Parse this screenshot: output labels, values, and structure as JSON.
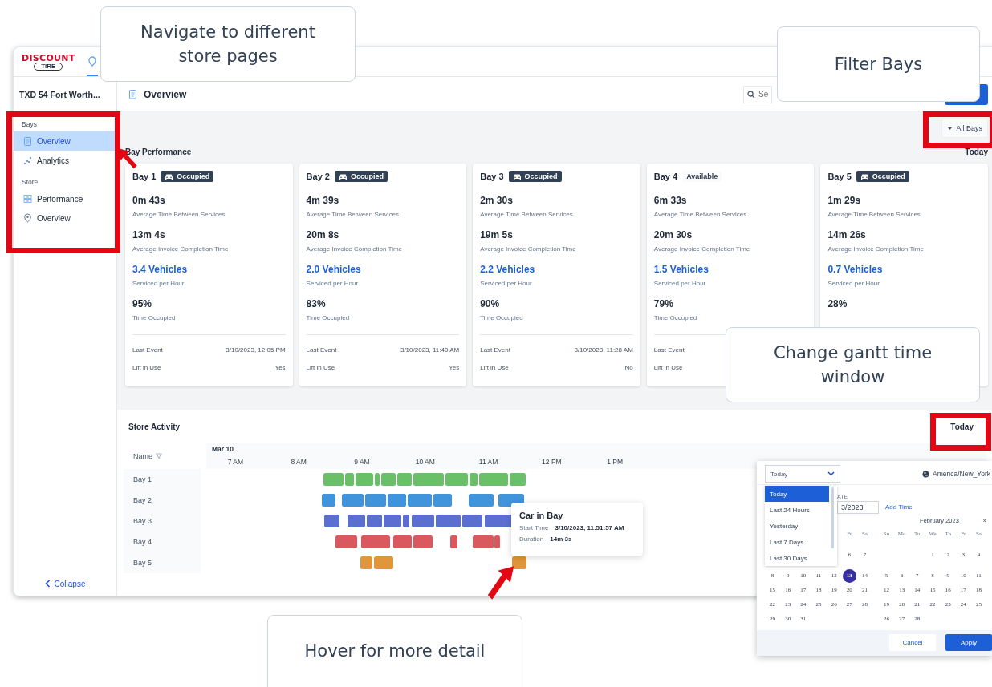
{
  "logo": {
    "top": "DISCOUNT",
    "bottom": "TIRE"
  },
  "sidebar": {
    "store": "TXD 54 Fort Worth...",
    "sections": [
      {
        "title": "Bays",
        "items": [
          {
            "label": "Overview",
            "selected": true
          },
          {
            "label": "Analytics",
            "selected": false
          }
        ]
      },
      {
        "title": "Store",
        "items": [
          {
            "label": "Performance",
            "selected": false
          },
          {
            "label": "Overview",
            "selected": false
          }
        ]
      }
    ],
    "collapse": "Collapse"
  },
  "page_title": "Overview",
  "search": {
    "placeholder": "Se"
  },
  "filter": {
    "label": "All Bays"
  },
  "bay_performance": {
    "title": "Bay Performance",
    "range": "Today",
    "cards": [
      {
        "name": "Bay 1",
        "status": {
          "kind": "occupied",
          "label": "Occupied"
        },
        "stats": [
          {
            "kind": "time",
            "value": "0m 43s",
            "label": "Average Time Between Services"
          },
          {
            "kind": "time",
            "value": "13m 4s",
            "label": "Average Invoice Completion Time"
          },
          {
            "kind": "rate",
            "value": "3.4 Vehicles",
            "label": "Serviced per Hour"
          },
          {
            "kind": "time",
            "value": "95%",
            "label": "Time Occupied"
          }
        ],
        "details": [
          {
            "label": "Last Event",
            "value": "3/10/2023, 12:05 PM"
          },
          {
            "label": "Lift in Use",
            "value": "Yes"
          }
        ]
      },
      {
        "name": "Bay 2",
        "status": {
          "kind": "occupied",
          "label": "Occupied"
        },
        "stats": [
          {
            "kind": "time",
            "value": "4m 39s",
            "label": "Average Time Between Services"
          },
          {
            "kind": "time",
            "value": "20m 8s",
            "label": "Average Invoice Completion Time"
          },
          {
            "kind": "rate",
            "value": "2.0 Vehicles",
            "label": "Serviced per Hour"
          },
          {
            "kind": "time",
            "value": "83%",
            "label": "Time Occupied"
          }
        ],
        "details": [
          {
            "label": "Last Event",
            "value": "3/10/2023, 11:40 AM"
          },
          {
            "label": "Lift in Use",
            "value": "Yes"
          }
        ]
      },
      {
        "name": "Bay 3",
        "status": {
          "kind": "occupied",
          "label": "Occupied"
        },
        "stats": [
          {
            "kind": "time",
            "value": "2m 30s",
            "label": "Average Time Between Services"
          },
          {
            "kind": "time",
            "value": "19m 5s",
            "label": "Average Invoice Completion Time"
          },
          {
            "kind": "rate",
            "value": "2.2 Vehicles",
            "label": "Serviced per Hour"
          },
          {
            "kind": "time",
            "value": "90%",
            "label": "Time Occupied"
          }
        ],
        "details": [
          {
            "label": "Last Event",
            "value": "3/10/2023, 11:28 AM"
          },
          {
            "label": "Lift in Use",
            "value": "No"
          }
        ]
      },
      {
        "name": "Bay 4",
        "status": {
          "kind": "available",
          "label": "Available"
        },
        "stats": [
          {
            "kind": "time",
            "value": "6m 33s",
            "label": "Average Time Between Services"
          },
          {
            "kind": "time",
            "value": "20m 30s",
            "label": "Average Invoice Completion Time"
          },
          {
            "kind": "rate",
            "value": "1.5 Vehicles",
            "label": "Serviced per Hour"
          },
          {
            "kind": "time",
            "value": "79%",
            "label": "Time Occupied"
          }
        ],
        "details": [
          {
            "label": "Last Event"
          },
          {
            "label": "Lift in Use"
          }
        ]
      },
      {
        "name": "Bay 5",
        "status": {
          "kind": "occupied",
          "label": "Occupied"
        },
        "stats": [
          {
            "kind": "time",
            "value": "1m 29s",
            "label": "Average Time Between Services"
          },
          {
            "kind": "time",
            "value": "14m 26s",
            "label": "Average Invoice Completion Time"
          },
          {
            "kind": "rate",
            "value": "0.7 Vehicles",
            "label": "Serviced per Hour"
          },
          {
            "kind": "time",
            "value": "28%"
          }
        ]
      }
    ]
  },
  "store_activity": {
    "title": "Store Activity",
    "range": "Today",
    "name_header": "Name",
    "date": "Mar 10",
    "ticks": [
      "7 AM",
      "8 AM",
      "9 AM",
      "10 AM",
      "11 AM",
      "12 PM",
      "1 PM"
    ],
    "rows": [
      {
        "name": "Bay 1",
        "color": "#6abf69"
      },
      {
        "name": "Bay 2",
        "color": "#3f94dc"
      },
      {
        "name": "Bay 3",
        "color": "#5b6fd0"
      },
      {
        "name": "Bay 4",
        "color": "#d9595e"
      },
      {
        "name": "Bay 5",
        "color": "#e0963a"
      }
    ]
  },
  "tooltip": {
    "title": "Car in Bay",
    "rows": [
      {
        "label": "Start Time",
        "value": "3/10/2023, 11:51:57 AM"
      },
      {
        "label": "Duration",
        "value": "14m 3s"
      }
    ]
  },
  "date_picker": {
    "preset": "Today",
    "timezone": "America/New_York",
    "options": [
      {
        "label": "Today",
        "selected": true
      },
      {
        "label": "Last 24 Hours",
        "selected": false
      },
      {
        "label": "Yesterday",
        "selected": false
      },
      {
        "label": "Last 7 Days",
        "selected": false
      },
      {
        "label": "Last 30 Days",
        "selected": false
      }
    ],
    "date_label": "ATE",
    "date_value": "3/2023",
    "add_time": "Add Time",
    "calendars": [
      {
        "weekdays": [
          "Fr",
          "Sa"
        ],
        "weeks": [
          [
            {
              "d": "6",
              "selected": false
            },
            {
              "d": "7",
              "selected": false
            }
          ],
          [
            {
              "d": "8",
              "selected": false
            },
            {
              "d": "9",
              "selected": false
            },
            {
              "d": "10",
              "selected": false
            },
            {
              "d": "11",
              "selected": false
            },
            {
              "d": "12",
              "selected": false
            },
            {
              "d": "13",
              "selected": true
            },
            {
              "d": "14",
              "selected": false
            }
          ],
          [
            {
              "d": "15",
              "selected": false
            },
            {
              "d": "16",
              "selected": false
            },
            {
              "d": "17",
              "selected": false
            },
            {
              "d": "18",
              "selected": false
            },
            {
              "d": "19",
              "selected": false
            },
            {
              "d": "20",
              "selected": false
            },
            {
              "d": "21",
              "selected": false
            }
          ],
          [
            {
              "d": "22",
              "selected": false
            },
            {
              "d": "23",
              "selected": false
            },
            {
              "d": "24",
              "selected": false
            },
            {
              "d": "25",
              "selected": false
            },
            {
              "d": "26",
              "selected": false
            },
            {
              "d": "27",
              "selected": false
            },
            {
              "d": "28",
              "selected": false
            }
          ],
          [
            {
              "d": "29",
              "selected": false
            },
            {
              "d": "30",
              "selected": false
            },
            {
              "d": "31",
              "selected": false
            }
          ]
        ]
      },
      {
        "title": "February 2023",
        "next": "»",
        "weekdays": [
          "Su",
          "Mo",
          "Tu",
          "We",
          "Th",
          "Fr",
          "Sa"
        ],
        "weeks": [
          [
            {
              "d": "1",
              "selected": false
            },
            {
              "d": "2",
              "selected": false
            },
            {
              "d": "3",
              "selected": false
            },
            {
              "d": "4",
              "selected": false
            }
          ],
          [
            {
              "d": "5",
              "selected": false
            },
            {
              "d": "6",
              "selected": false
            },
            {
              "d": "7",
              "selected": false
            },
            {
              "d": "8",
              "selected": false
            },
            {
              "d": "9",
              "selected": false
            },
            {
              "d": "10",
              "selected": false
            },
            {
              "d": "11",
              "selected": false
            }
          ],
          [
            {
              "d": "12",
              "selected": false
            },
            {
              "d": "13",
              "selected": false
            },
            {
              "d": "14",
              "selected": false
            },
            {
              "d": "15",
              "selected": false
            },
            {
              "d": "16",
              "selected": false
            },
            {
              "d": "17",
              "selected": false
            },
            {
              "d": "18",
              "selected": false
            }
          ],
          [
            {
              "d": "19",
              "selected": false
            },
            {
              "d": "20",
              "selected": false
            },
            {
              "d": "21",
              "selected": false
            },
            {
              "d": "22",
              "selected": false
            },
            {
              "d": "23",
              "selected": false
            },
            {
              "d": "24",
              "selected": false
            },
            {
              "d": "25",
              "selected": false
            }
          ],
          [
            {
              "d": "26",
              "selected": false
            },
            {
              "d": "27",
              "selected": false
            },
            {
              "d": "28",
              "selected": false
            }
          ]
        ]
      }
    ],
    "buttons": {
      "cancel": "Cancel",
      "apply": "Apply"
    }
  },
  "callouts": [
    {
      "text": "Navigate to different store pages"
    },
    {
      "text": "Filter Bays"
    },
    {
      "text": "Change gantt time window"
    },
    {
      "text": "Hover for more detail"
    }
  ]
}
